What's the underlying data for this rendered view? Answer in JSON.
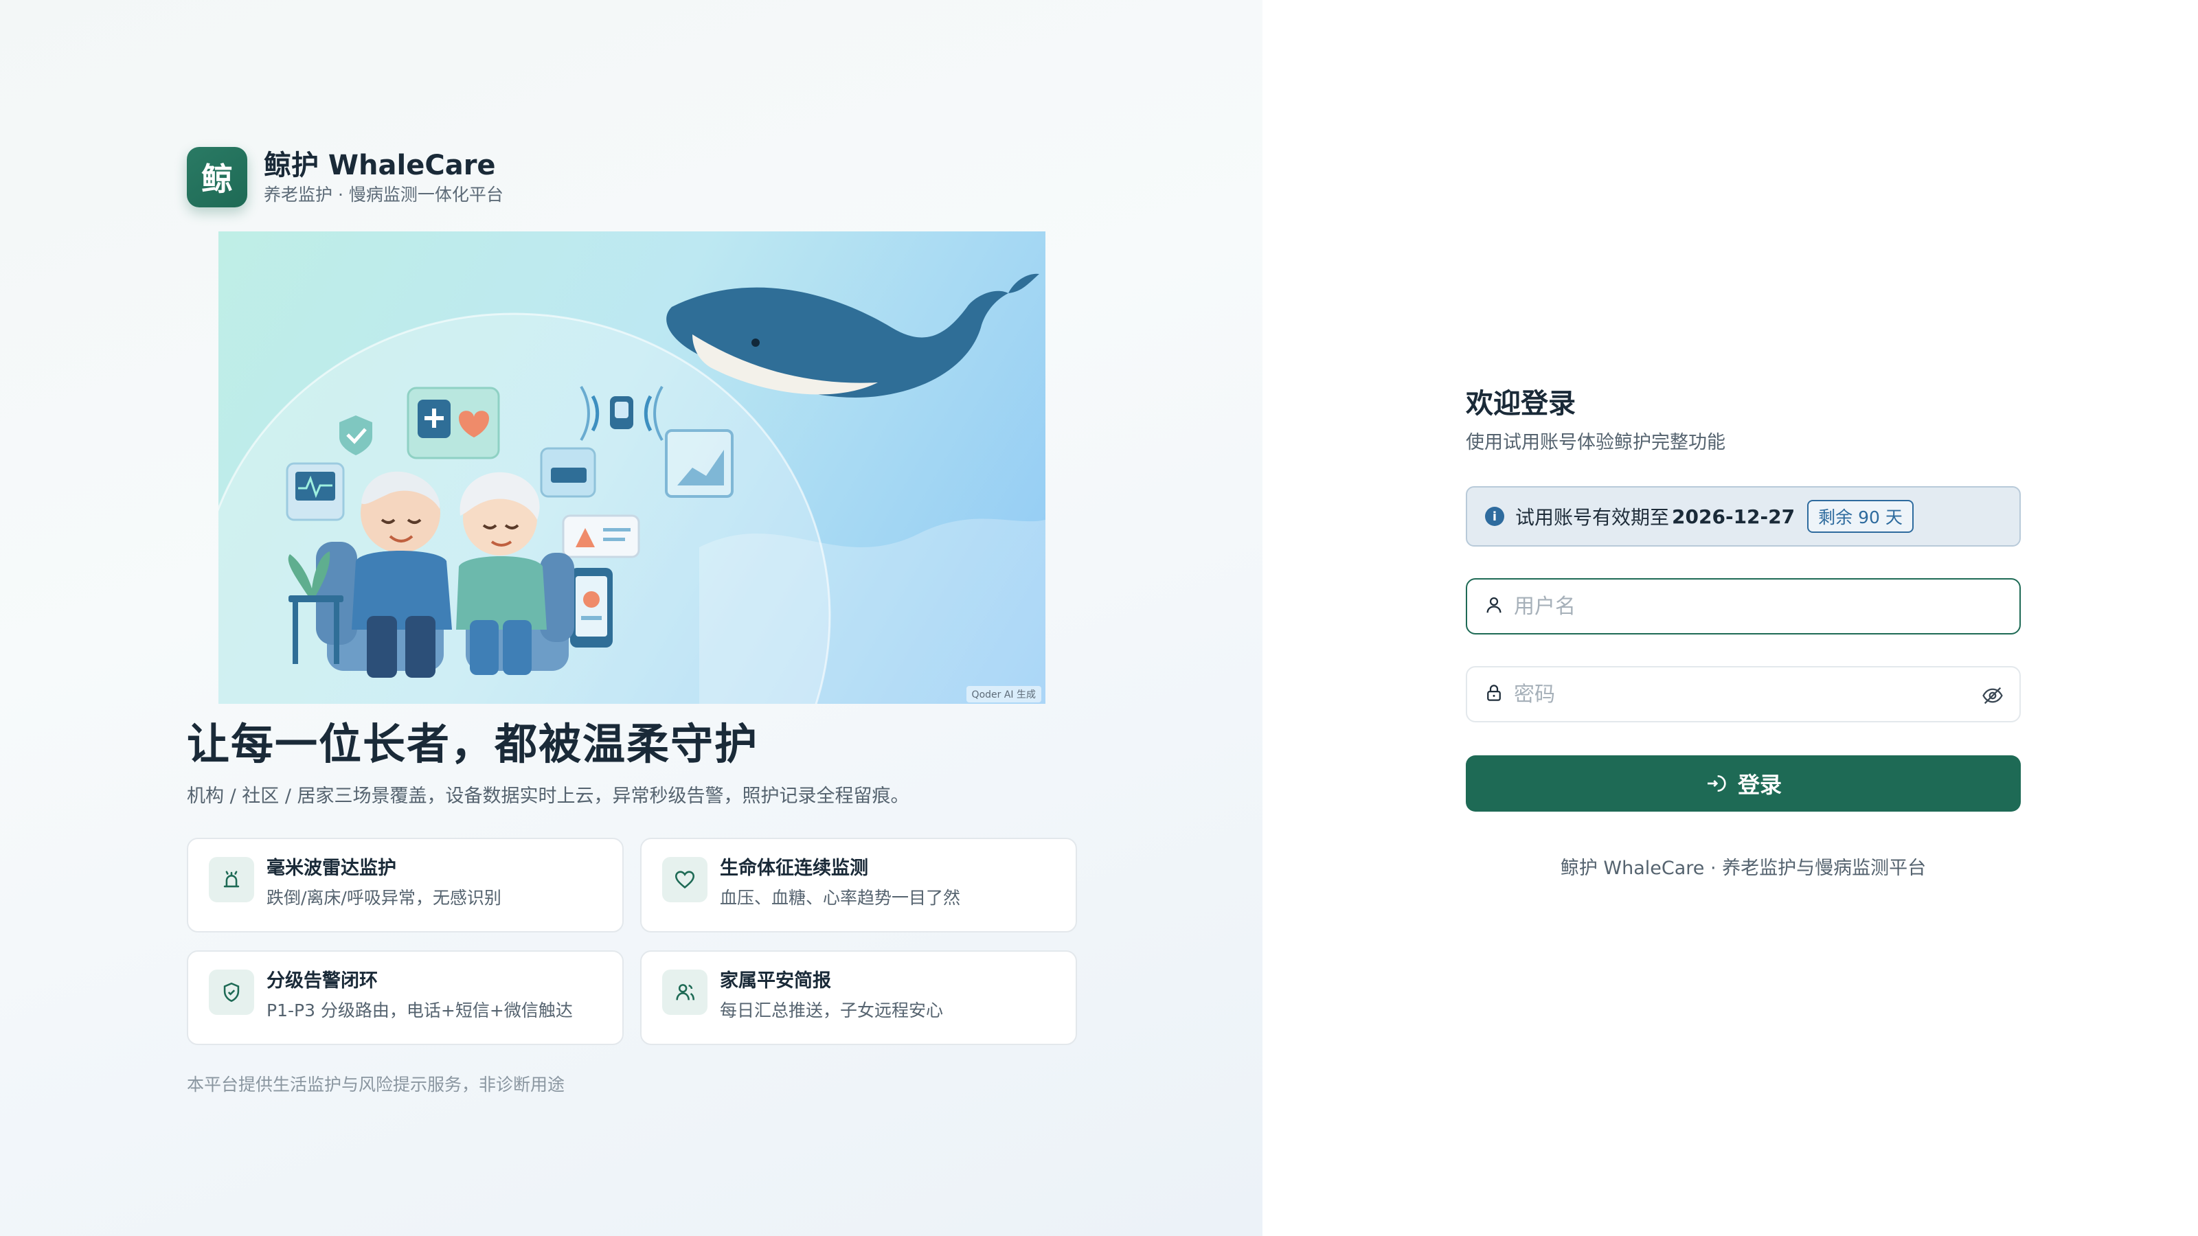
{
  "brand": {
    "logo_char": "鲸",
    "name": "鲸护 WhaleCare",
    "subtitle": "养老监护 · 慢病监测一体化平台"
  },
  "hero": {
    "credit": "Qoder AI 生成"
  },
  "headline": "让每一位长者，都被温柔守护",
  "subline": "机构 / 社区 / 居家三场景覆盖，设备数据实时上云，异常秒级告警，照护记录全程留痕。",
  "features": [
    {
      "icon": "radar-icon",
      "title": "毫米波雷达监护",
      "desc": "跌倒/离床/呼吸异常，无感识别"
    },
    {
      "icon": "heart-icon",
      "title": "生命体征连续监测",
      "desc": "血压、血糖、心率趋势一目了然"
    },
    {
      "icon": "shield-check-icon",
      "title": "分级告警闭环",
      "desc": "P1-P3 分级路由，电话+短信+微信触达"
    },
    {
      "icon": "family-icon",
      "title": "家属平安简报",
      "desc": "每日汇总推送，子女远程安心"
    }
  ],
  "disclaimer": "本平台提供生活监护与风险提示服务，非诊断用途",
  "login": {
    "title": "欢迎登录",
    "subtitle": "使用试用账号体验鲸护完整功能",
    "trial_text": "试用账号有效期至",
    "trial_date": "2026-12-27",
    "trial_badge": "剩余 90 天",
    "username_placeholder": "用户名",
    "username_value": "",
    "password_placeholder": "密码",
    "password_value": "",
    "button_label": "登录",
    "footer": "鲸护 WhaleCare · 养老监护与慢病监测平台"
  },
  "colors": {
    "brand": "#1e6a55",
    "info": "#2e6b9e",
    "text": "#1a2a38"
  }
}
